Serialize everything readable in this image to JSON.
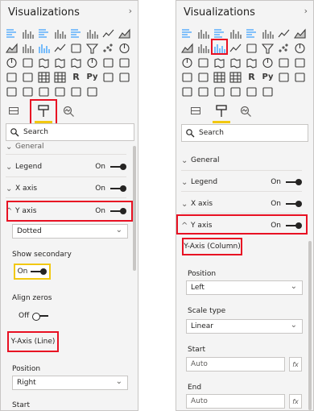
{
  "left": {
    "title": "Visualizations",
    "search_placeholder": "Search",
    "rows": [
      {
        "label": "General",
        "state": ""
      },
      {
        "label": "Legend",
        "state": "On"
      },
      {
        "label": "X axis",
        "state": "On"
      },
      {
        "label": "Y axis",
        "state": "On"
      }
    ],
    "line_style_value": "Dotted",
    "show_secondary_label": "Show secondary",
    "show_secondary_state": "On",
    "align_zeros_label": "Align zeros",
    "align_zeros_state": "Off",
    "secondary_heading": "Y-Axis (Line)",
    "position_label": "Position",
    "position_value": "Right",
    "start_label": "Start"
  },
  "right": {
    "title": "Visualizations",
    "search_placeholder": "Search",
    "rows": [
      {
        "label": "General",
        "state": ""
      },
      {
        "label": "Legend",
        "state": "On"
      },
      {
        "label": "X axis",
        "state": "On"
      },
      {
        "label": "Y axis",
        "state": "On"
      }
    ],
    "primary_heading": "Y-Axis (Column)",
    "position_label": "Position",
    "position_value": "Left",
    "scale_label": "Scale type",
    "scale_value": "Linear",
    "start_label": "Start",
    "start_value": "Auto",
    "end_label": "End",
    "end_value": "Auto",
    "fx": "fx"
  },
  "colors": {
    "highlight": "#e81123",
    "accent": "#f2c811",
    "active_icon": "#118dff"
  }
}
